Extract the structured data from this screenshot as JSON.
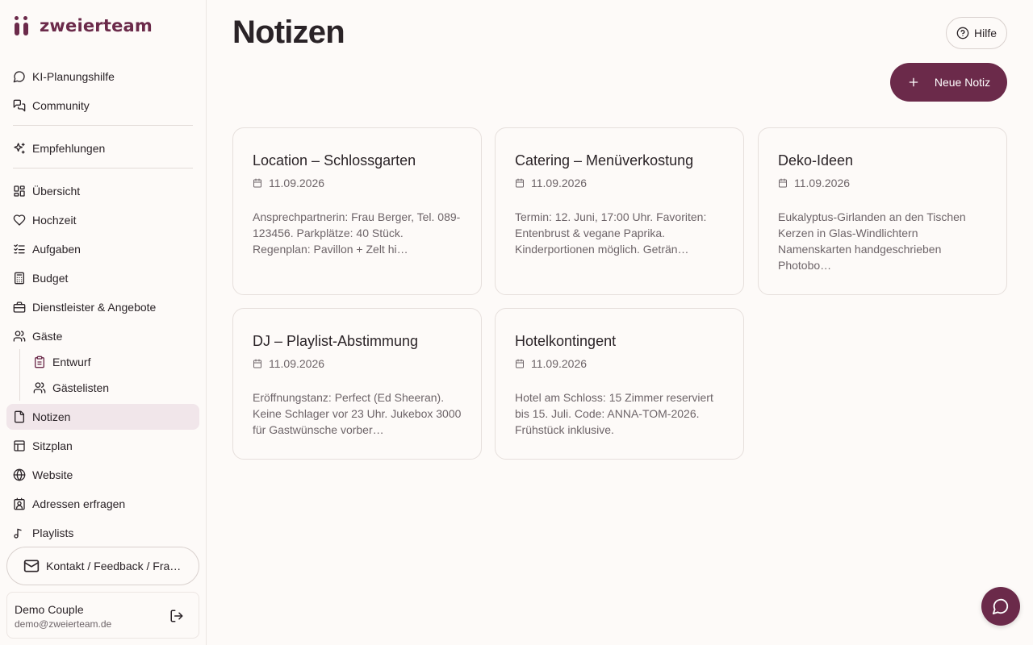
{
  "app": {
    "name": "zweierteam"
  },
  "sidebar": {
    "items": [
      {
        "label": "KI-Planungshilfe",
        "icon": "chat-bubble-icon"
      },
      {
        "label": "Community",
        "icon": "messages-icon"
      },
      {
        "label": "Empfehlungen",
        "icon": "sparkles-icon"
      },
      {
        "label": "Übersicht",
        "icon": "dashboard-icon"
      },
      {
        "label": "Hochzeit",
        "icon": "heart-icon"
      },
      {
        "label": "Aufgaben",
        "icon": "task-list-icon"
      },
      {
        "label": "Budget",
        "icon": "calculator-icon"
      },
      {
        "label": "Dienstleister & Angebote",
        "icon": "briefcase-icon"
      },
      {
        "label": "Gäste",
        "icon": "users-icon"
      },
      {
        "label": "Entwurf",
        "icon": "clipboard-icon"
      },
      {
        "label": "Gästelisten",
        "icon": "users-icon"
      },
      {
        "label": "Notizen",
        "icon": "file-icon",
        "active": true
      },
      {
        "label": "Sitzplan",
        "icon": "layout-icon"
      },
      {
        "label": "Website",
        "icon": "globe-icon"
      },
      {
        "label": "Adressen erfragen",
        "icon": "contact-card-icon"
      },
      {
        "label": "Playlists",
        "icon": "music-note-icon"
      }
    ],
    "contact_label": "Kontakt / Feedback / Fragen",
    "user": {
      "name": "Demo Couple",
      "email": "demo@zweierteam.de"
    }
  },
  "main": {
    "title": "Notizen",
    "help_label": "Hilfe",
    "new_note_label": "Neue Notiz",
    "notes": [
      {
        "title": "Location – Schlossgarten",
        "date": "11.09.2026",
        "body": "Ansprechpartnerin: Frau Berger, Tel. 089-123456. Parkplätze: 40 Stück. Regenplan: Pavillon + Zelt hi…"
      },
      {
        "title": "Catering – Menüverkostung",
        "date": "11.09.2026",
        "body": "Termin: 12. Juni, 17:00 Uhr. Favoriten: Entenbrust & vegane Paprika. Kinderportionen möglich. Geträn…"
      },
      {
        "title": "Deko-Ideen",
        "date": "11.09.2026",
        "body": "Eukalyptus-Girlanden an den Tischen Kerzen in Glas-Windlichtern Namenskarten handgeschrieben Photobo…"
      },
      {
        "title": "DJ – Playlist-Abstimmung",
        "date": "11.09.2026",
        "body": "Eröffnungstanz: Perfect (Ed Sheeran). Keine Schlager vor 23 Uhr. Jukebox 3000 für Gastwünsche vorber…"
      },
      {
        "title": "Hotelkontingent",
        "date": "11.09.2026",
        "body": "Hotel am Schloss: 15 Zimmer reserviert bis 15. Juli. Code: ANNA-TOM-2026. Frühstück inklusive."
      }
    ]
  },
  "colors": {
    "brand": "#6b2a4a",
    "active_bg": "#f1e6ea",
    "background": "#fdfaf8"
  }
}
